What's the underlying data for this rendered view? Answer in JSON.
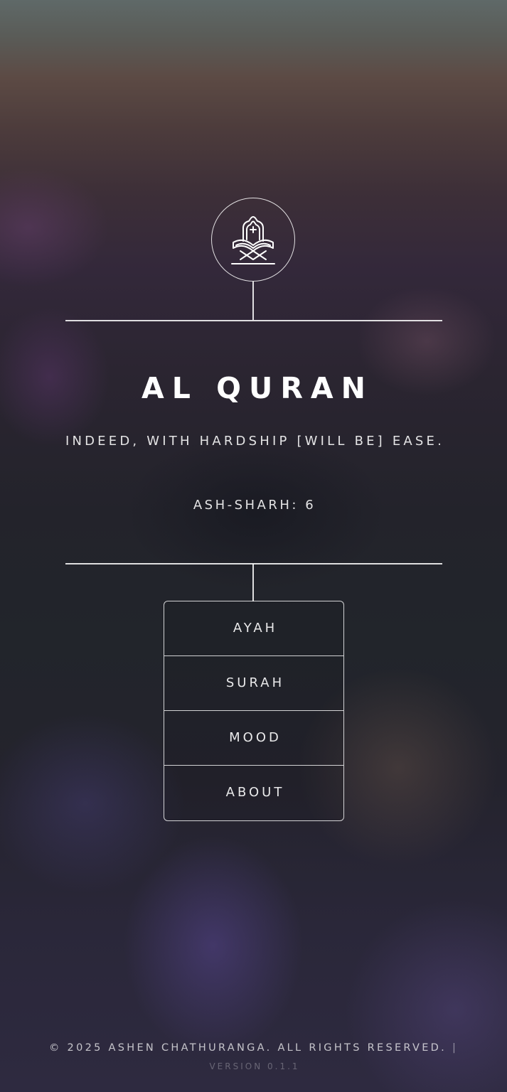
{
  "app": {
    "title": "AL QURAN",
    "logo_icon": "quran-on-stand-icon"
  },
  "verse": {
    "text": "INDEED, WITH HARDSHIP [WILL BE] EASE.",
    "reference": "ASH-SHARH: 6"
  },
  "menu": {
    "items": [
      {
        "label": "AYAH"
      },
      {
        "label": "SURAH"
      },
      {
        "label": "MOOD"
      },
      {
        "label": "ABOUT"
      }
    ]
  },
  "footer": {
    "copyright": "© 2025 ASHEN CHATHURANGA. ALL RIGHTS RESERVED.",
    "separator": "|",
    "version": "VERSION 0.1.1"
  },
  "colors": {
    "text": "#ffffff",
    "line": "#ffffff",
    "background_top": "#5f6968",
    "background_mid": "#23232b",
    "background_bottom": "#2e2a40"
  }
}
